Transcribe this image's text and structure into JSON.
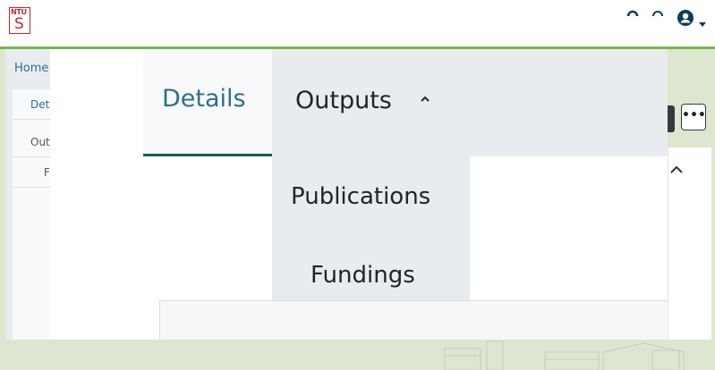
{
  "brand": {
    "logo_text": "NTU"
  },
  "navbar": {
    "icons": [
      "help-icon",
      "notifications-icon",
      "user-account-icon",
      "caret-down-icon"
    ]
  },
  "breadcrumb": {
    "home": "Home"
  },
  "sidebar": {
    "items": [
      {
        "label": "Det"
      },
      {
        "label": "Out"
      },
      {
        "label": "F"
      }
    ]
  },
  "tabs": {
    "details": "Details",
    "outputs": "Outputs",
    "outputs_chevron": "^"
  },
  "dropdown": {
    "items": [
      {
        "label": "Publications"
      },
      {
        "label": "Fundings"
      }
    ]
  },
  "toolbar": {
    "more_label": "•••"
  },
  "panel": {
    "collapse_chevron": "^"
  },
  "colors": {
    "accent": "#2e6f8e",
    "active_tab_border": "#155e5a",
    "nav_green": "#7bb44c",
    "logo_red": "#c1272d"
  }
}
